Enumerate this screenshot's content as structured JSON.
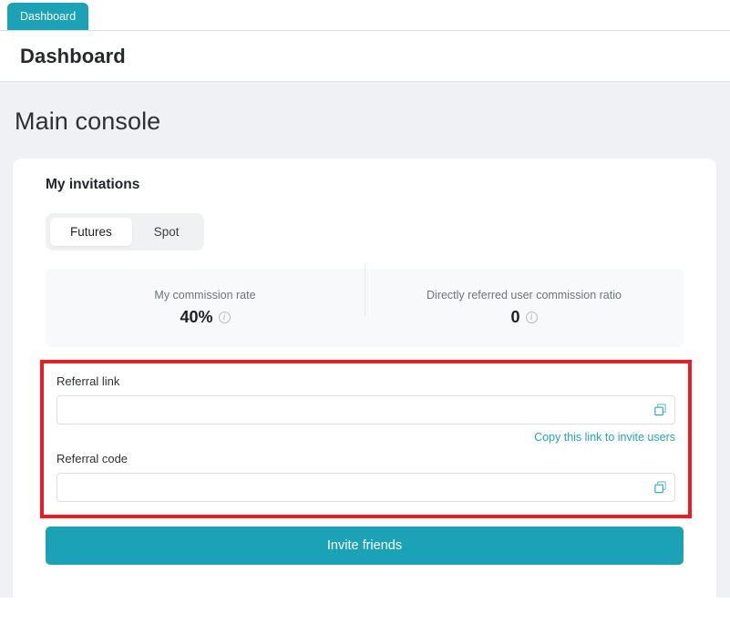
{
  "browser": {
    "tab_label": "Dashboard"
  },
  "header": {
    "title": "Dashboard"
  },
  "page": {
    "title": "Main console"
  },
  "card": {
    "title": "My invitations",
    "tabs": [
      {
        "label": "Futures",
        "active": true
      },
      {
        "label": "Spot",
        "active": false
      }
    ],
    "stats": [
      {
        "label": "My commission rate",
        "value": "40%",
        "info": "i"
      },
      {
        "label": "Directly referred user commission ratio",
        "value": "0",
        "info": "i"
      }
    ],
    "referral": {
      "link_label": "Referral link",
      "link_value": "",
      "link_placeholder": "",
      "helper_link": "Copy this link to invite users",
      "code_label": "Referral code",
      "code_value": "",
      "code_placeholder": ""
    },
    "cta_label": "Invite friends"
  },
  "colors": {
    "accent": "#1ba2b6",
    "link": "#25a3b8",
    "highlight": "#ed1c24",
    "page_bg": "#eff1f5",
    "panel_bg": "#f8f9fa"
  }
}
